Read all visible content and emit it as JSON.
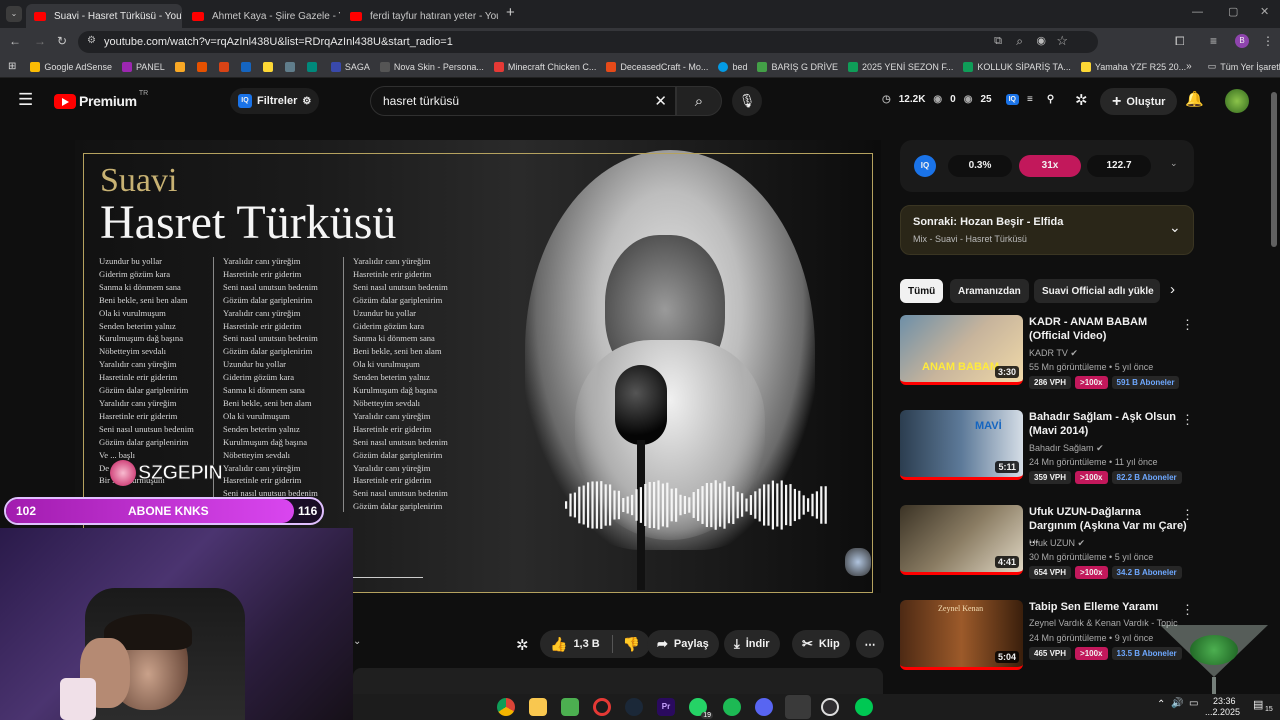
{
  "browser": {
    "tabs": [
      {
        "label": "Suavi - Hasret Türküsü - YouTu",
        "active": true
      },
      {
        "label": "Ahmet Kaya - Şiire Gazele - You",
        "active": false
      },
      {
        "label": "ferdi tayfur hatıran yeter - YouT",
        "active": false
      }
    ],
    "url": "youtube.com/watch?v=rqAzInl438U&list=RDrqAzInl438U&start_radio=1",
    "bookmarks": [
      "Google AdSense",
      "PANEL",
      "SAGA",
      "Nova Skin - Persona...",
      "Minecraft Chicken C...",
      "DeceasedCraft - Mo...",
      "bed",
      "BARIŞ G DRİVE",
      "2025 YENİ SEZON F...",
      "KOLLUK SİPARİŞ TA...",
      "Yamaha YZF R25 20...",
      "Tüm Yer İşaretleri"
    ]
  },
  "youtube": {
    "logo": "Premium",
    "logo_sup": "TR",
    "filters_label": "Filtreler",
    "search_value": "hasret türküsü",
    "stats": {
      "views": "12.2K",
      "a": "0",
      "b": "25"
    },
    "create_label": "Oluştur"
  },
  "video": {
    "artist": "Suavi",
    "song": "Hasret Türküsü",
    "lyrics_col1": [
      "Uzundur bu yollar",
      "Giderim gözüm kara",
      "Sanma ki dönmem sana",
      "Beni bekle, seni ben alam",
      "Ola ki vurulmuşum",
      "Senden beterim yalnız",
      "Kurulmuşum dağ başına",
      "Nöbetteyim sevdalı",
      "Yaralıdır canı yüreğim",
      "Hasretinle erir giderim",
      "Gözüm dalar gariplenirim",
      "Yaralıdır canı yüreğim",
      "Hasretinle erir giderim",
      "Seni nasıl unutsun bedenim",
      "Gözüm dalar gariplenirim",
      "Ve ... başlı",
      "De ...",
      "Bir ... tutturmuşum"
    ],
    "lyrics_col2": [
      "Yaralıdır canı yüreğim",
      "Hasretinle erir giderim",
      "Seni nasıl unutsun bedenim",
      "Gözüm dalar gariplenirim",
      "Yaralıdır canı yüreğim",
      "Hasretinle erir giderim",
      "Seni nasıl unutsun bedenim",
      "Gözüm dalar gariplenirim",
      "Uzundur bu yollar",
      "Giderim gözüm kara",
      "Sanma ki dönmem sana",
      "Beni bekle, seni ben alam",
      "Ola ki vurulmuşum",
      "Senden beterim yalnız",
      "Kurulmuşum dağ başına",
      "Nöbetteyim sevdalı",
      "Yaralıdır canı yüreğim",
      "Hasretinle erir giderim",
      "Seni nasıl unutsun bedenim",
      "Gözüm dalar gariplenirim"
    ],
    "lyrics_col3": [
      "Yaralıdır canı yüreğim",
      "Hasretinle erir giderim",
      "Seni nasıl unutsun bedenim",
      "Gözüm dalar gariplenirim",
      "Uzundur bu yollar",
      "Giderim gözüm kara",
      "Sanma ki dönmem sana",
      "Beni bekle, seni ben alam",
      "Ola ki vurulmuşum",
      "Senden beterim yalnız",
      "Kurulmuşum dağ başına",
      "Nöbetteyim sevdalı",
      "Yaralıdır canı yüreğim",
      "Hasretinle erir giderim",
      "Seni nasıl unutsun bedenim",
      "Gözüm dalar gariplenirim",
      "Yaralıdır canı yüreğim",
      "Hasretinle erir giderim",
      "Seni nasıl unutsun bedenim",
      "Gözüm dalar gariplenirim"
    ]
  },
  "overlay": {
    "bar_left": "102",
    "bar_label": "ABONE KNKS",
    "bar_right": "116",
    "logo_text": "SZGEPIN",
    "progress": 0.91
  },
  "actions": {
    "like": "1,3 B",
    "share": "Paylaş",
    "download": "İndir",
    "clip": "Klip"
  },
  "sidebar": {
    "iq_stats": [
      "0.3%",
      "31x",
      "122.7"
    ],
    "next_title": "Sonraki: Hozan Beşir - Elfida",
    "next_sub": "Mix - Suavi - Hasret Türküsü",
    "chips": [
      "Tümü",
      "Aramanızdan",
      "Suavi Official adlı yükle"
    ],
    "recs": [
      {
        "title": "KADR - ANAM BABAM (Official Video)",
        "channel": "KADR TV",
        "meta": "55 Mn görüntüleme • 5 yıl önce",
        "vph": "286 VPH",
        "mult": ">100x",
        "subs": "591 B Aboneler",
        "duration": "3:30",
        "thumb_text": "ANAM BABAM"
      },
      {
        "title": "Bahadır Sağlam - Aşk Olsun (Mavi 2014)",
        "channel": "Bahadır Sağlam",
        "meta": "24 Mn görüntüleme • 11 yıl önce",
        "vph": "359 VPH",
        "mult": ">100x",
        "subs": "82.2 B Aboneler",
        "duration": "5:11",
        "thumb_text": "MAVİ"
      },
      {
        "title": "Ufuk UZUN-Dağlarına Dargınım (Aşkına Var mı Çare) ...",
        "channel": "Ufuk UZUN",
        "meta": "30 Mn görüntüleme • 5 yıl önce",
        "vph": "654 VPH",
        "mult": ">100x",
        "subs": "34.2 B Aboneler",
        "duration": "4:41",
        "thumb_text": ""
      },
      {
        "title": "Tabip Sen Elleme Yaramı",
        "channel": "Zeynel Vardık & Kenan Vardık - Topic",
        "meta": "24 Mn görüntüleme • 9 yıl önce",
        "vph": "465 VPH",
        "mult": ">100x",
        "subs": "13.5 B Aboneler",
        "duration": "5:04",
        "thumb_text": "Zeynel Kenan"
      }
    ]
  },
  "taskbar": {
    "time": "23:36",
    "date": "...2.2025",
    "notif": "15",
    "whatsapp_badge": "19"
  },
  "colors": {
    "accent_red": "#ff0000",
    "pink": "#c2185b",
    "purple_bar": "#c026d3",
    "gold_border": "#b5a25f"
  }
}
